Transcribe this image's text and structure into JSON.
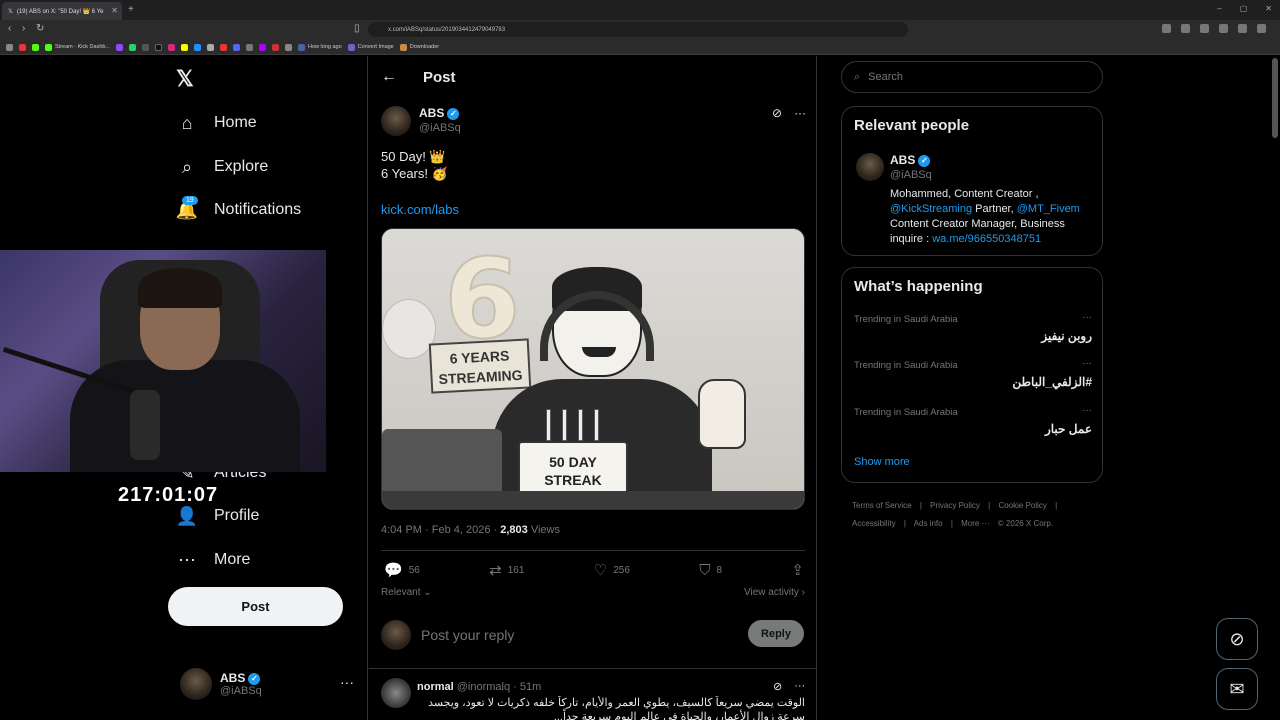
{
  "browser": {
    "tab_title": "(19) ABS on X: \"50 Day! 👑 6 Ye",
    "url": "x.com/iABSq/status/2019034412479049783",
    "bookmarks": [
      "Stream - Kick Dashb...",
      "How long ago",
      "Convert Image",
      "Downloader"
    ]
  },
  "nav": {
    "logo": "𝕏",
    "items": [
      {
        "label": "Home"
      },
      {
        "label": "Explore"
      },
      {
        "label": "Notifications"
      },
      {
        "label": "Articles"
      },
      {
        "label": "Profile"
      },
      {
        "label": "More"
      }
    ],
    "notifications_badge": "19",
    "post_button": "Post",
    "account": {
      "name": "ABS",
      "handle": "@iABSq",
      "menu": "···"
    }
  },
  "overlay": {
    "timer": "217:01:07"
  },
  "post": {
    "header_title": "Post",
    "author_name": "ABS",
    "author_handle": "@iABSq",
    "text_line1": "50 Day! 👑",
    "text_line2": "6 Years! 🥳",
    "link": "kick.com/labs",
    "image_sign": "6 YEARS STREAMING",
    "image_cake": "50 DAY STREAK",
    "time": "4:04 PM · Feb 4, 2026 · ",
    "views_count": "2,803",
    "views_label": " Views",
    "replies": "56",
    "reposts": "161",
    "likes": "256",
    "bookmarks": "8",
    "sort_label": "Relevant",
    "view_activity": "View activity",
    "reply_placeholder": "Post your reply",
    "reply_button": "Reply"
  },
  "reply": {
    "name": "normal",
    "handle": "@inormalq · 51m",
    "text": "الوقت يمضي سريعاً كالسيف، يطوي العمر والأيام، تاركاً خلفه ذكريات لا تعود، ويجسد سرعة زوال الأعمار، والحياة في عالم اليوم سريعة جداً..."
  },
  "right": {
    "search_placeholder": "Search",
    "relevant_title": "Relevant people",
    "rp_name": "ABS",
    "rp_handle": "@iABSq",
    "rp_bio_1": "Mohammed, Content Creator ,",
    "rp_bio_link1": "@KickStreaming",
    "rp_bio_2": " Partner, ",
    "rp_bio_link2": "@MT_Fivem",
    "rp_bio_3": "Content Creator Manager, Business inquire : ",
    "rp_bio_link3": "wa.me/966550348751",
    "happening_title": "What’s happening",
    "trends": [
      {
        "context": "Trending in Saudi Arabia",
        "title": "روبن نيفيز"
      },
      {
        "context": "Trending in Saudi Arabia",
        "title": "#الزلفي_الباطن"
      },
      {
        "context": "Trending in Saudi Arabia",
        "title": "عمل حبار"
      }
    ],
    "show_more": "Show more",
    "footer": [
      "Terms of Service",
      "|",
      "Privacy Policy",
      "|",
      "Cookie Policy",
      "|",
      "Accessibility",
      "|",
      "Ads info",
      "|",
      "More ···",
      "© 2026 X Corp."
    ]
  },
  "colors": {
    "accent": "#1d9bf0",
    "background": "#000000",
    "text": "#e7e9ea",
    "muted": "#71767b"
  }
}
